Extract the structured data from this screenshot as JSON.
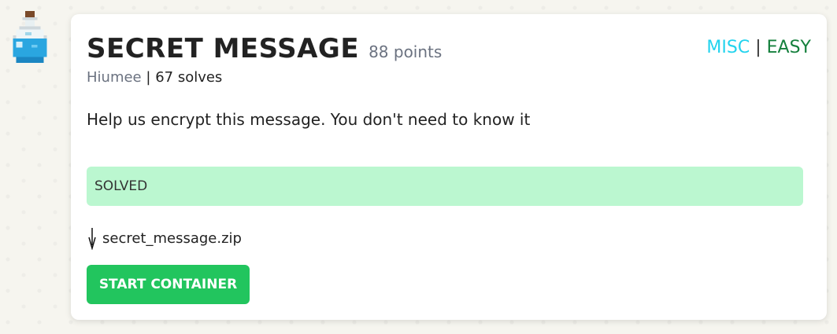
{
  "challenge": {
    "title": "SECRET MESSAGE",
    "points": "88 points",
    "author": "Hiumee",
    "separator": "|",
    "solves": "67 solves",
    "category": "MISC",
    "tag_separator": "|",
    "difficulty": "EASY",
    "description": "Help us encrypt this message. You don't need to know it",
    "status": "SOLVED",
    "file_name": "secret_message.zip",
    "start_button_label": "START CONTAINER"
  },
  "icons": {
    "potion": "potion-bottle-icon",
    "file": "download-arrow-icon"
  },
  "colors": {
    "category": "#22d3ee",
    "difficulty": "#15803d",
    "solved_bg": "#bbf7d0",
    "button_bg": "#22c55e"
  }
}
